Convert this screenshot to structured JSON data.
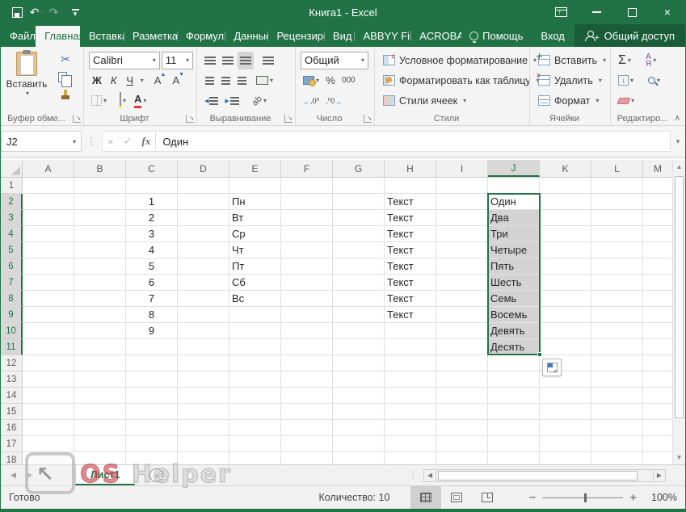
{
  "titlebar": {
    "title": "Книга1 - Excel"
  },
  "tabs": {
    "file": "Файл",
    "items": [
      "Главная",
      "Вставка",
      "Разметка с",
      "Формулы",
      "Данные",
      "Рецензиров",
      "Вид",
      "ABBYY Fine",
      "ACROBAT"
    ],
    "active": "Главная",
    "help": "Помощь",
    "signin": "Вход",
    "share": "Общий доступ"
  },
  "ribbon": {
    "clipboard": {
      "label": "Буфер обме...",
      "paste": "Вставить"
    },
    "font": {
      "label": "Шрифт",
      "family": "Calibri",
      "size": "11",
      "bold": "Ж",
      "italic": "К",
      "underline": "Ч",
      "grow": "А",
      "shrink": "А",
      "color": "А"
    },
    "alignment": {
      "label": "Выравнивание",
      "orientation": "ab"
    },
    "number": {
      "label": "Число",
      "format": "Общий",
      "percent": "%",
      "thousands": "000",
      "inc_dec": "←0 ,00",
      "dec_dec": ",00 →0"
    },
    "styles": {
      "label": "Стили",
      "items": [
        "Условное форматирование",
        "Форматировать как таблицу",
        "Стили ячеек"
      ]
    },
    "cells": {
      "label": "Ячейки",
      "items": [
        "Вставить",
        "Удалить",
        "Формат"
      ]
    },
    "editing": {
      "label": "Редактиро...",
      "autosum": "Σ",
      "sort_top": "А",
      "sort_bottom": "Я"
    }
  },
  "formula_bar": {
    "name_box": "J2",
    "cancel": "×",
    "enter": "✓",
    "fx": "fx",
    "value": "Один"
  },
  "grid": {
    "columns": [
      "A",
      "B",
      "C",
      "D",
      "E",
      "F",
      "G",
      "H",
      "I",
      "J",
      "K",
      "L",
      "M"
    ],
    "row_count": 18,
    "selection": {
      "column": "J",
      "first_row": 2,
      "last_row": 11,
      "active_cell": "J2"
    },
    "cells": [
      {
        "cell": "C2",
        "value": "1",
        "align": "center"
      },
      {
        "cell": "C3",
        "value": "2",
        "align": "center"
      },
      {
        "cell": "C4",
        "value": "3",
        "align": "center"
      },
      {
        "cell": "C5",
        "value": "4",
        "align": "center"
      },
      {
        "cell": "C6",
        "value": "5",
        "align": "center"
      },
      {
        "cell": "C7",
        "value": "6",
        "align": "center"
      },
      {
        "cell": "C8",
        "value": "7",
        "align": "center"
      },
      {
        "cell": "C9",
        "value": "8",
        "align": "center"
      },
      {
        "cell": "C10",
        "value": "9",
        "align": "center"
      },
      {
        "cell": "E2",
        "value": "Пн",
        "align": "left"
      },
      {
        "cell": "E3",
        "value": "Вт",
        "align": "left"
      },
      {
        "cell": "E4",
        "value": "Ср",
        "align": "left"
      },
      {
        "cell": "E5",
        "value": "Чт",
        "align": "left"
      },
      {
        "cell": "E6",
        "value": "Пт",
        "align": "left"
      },
      {
        "cell": "E7",
        "value": "Сб",
        "align": "left"
      },
      {
        "cell": "E8",
        "value": "Вс",
        "align": "left"
      },
      {
        "cell": "H2",
        "value": "Текст",
        "align": "left"
      },
      {
        "cell": "H3",
        "value": "Текст",
        "align": "left"
      },
      {
        "cell": "H4",
        "value": "Текст",
        "align": "left"
      },
      {
        "cell": "H5",
        "value": "Текст",
        "align": "left"
      },
      {
        "cell": "H6",
        "value": "Текст",
        "align": "left"
      },
      {
        "cell": "H7",
        "value": "Текст",
        "align": "left"
      },
      {
        "cell": "H8",
        "value": "Текст",
        "align": "left"
      },
      {
        "cell": "H9",
        "value": "Текст",
        "align": "left"
      },
      {
        "cell": "J2",
        "value": "Один",
        "align": "left"
      },
      {
        "cell": "J3",
        "value": "Два",
        "align": "left"
      },
      {
        "cell": "J4",
        "value": "Три",
        "align": "left"
      },
      {
        "cell": "J5",
        "value": "Четыре",
        "align": "left"
      },
      {
        "cell": "J6",
        "value": "Пять",
        "align": "left"
      },
      {
        "cell": "J7",
        "value": "Шесть",
        "align": "left"
      },
      {
        "cell": "J8",
        "value": "Семь",
        "align": "left"
      },
      {
        "cell": "J9",
        "value": "Восемь",
        "align": "left"
      },
      {
        "cell": "J10",
        "value": "Девять",
        "align": "left"
      },
      {
        "cell": "J11",
        "value": "Десять",
        "align": "left"
      }
    ]
  },
  "sheet_bar": {
    "tab": "Лист1"
  },
  "status_bar": {
    "mode": "Готово",
    "count": "Количество: 10",
    "zoom": "100%"
  },
  "watermark": {
    "os": "OS",
    "helper": "Helper"
  },
  "colors": {
    "brand_green": "#217346",
    "share_green": "#1a5c38",
    "selection_fill": "#d3d3d3",
    "fill_yellow": "#ffe400",
    "font_red": "#e03c32"
  }
}
